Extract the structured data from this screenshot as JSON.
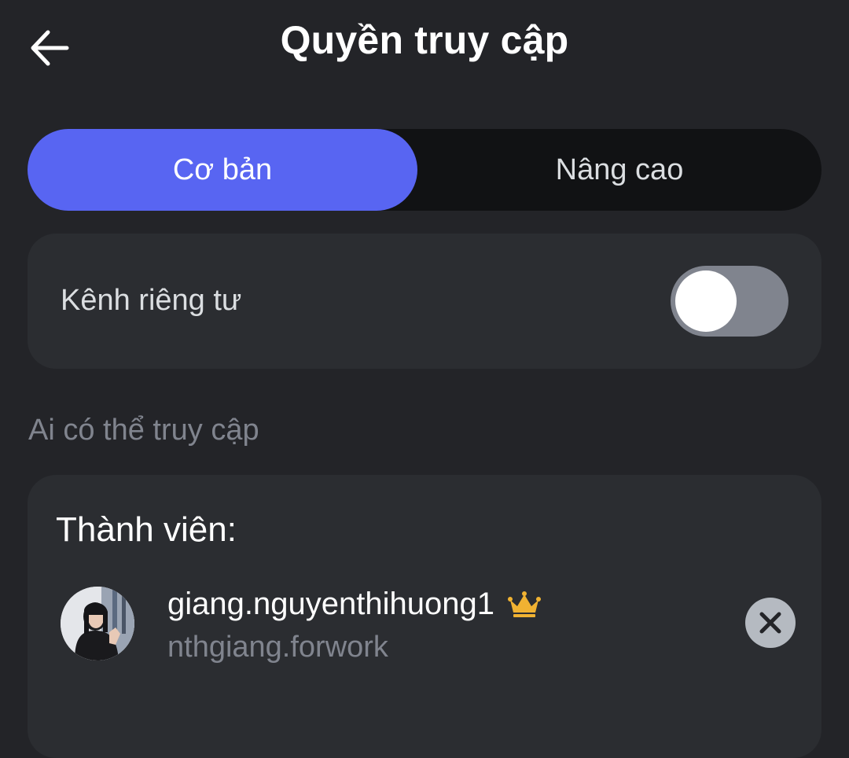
{
  "header": {
    "title": "Quyền truy cập",
    "back_icon": "arrow-left-icon"
  },
  "tabs": [
    {
      "label": "Cơ bản",
      "active": true
    },
    {
      "label": "Nâng cao",
      "active": false
    }
  ],
  "private_channel": {
    "label": "Kênh riêng tư",
    "enabled": false
  },
  "access_section": {
    "label": "Ai có thể truy cập"
  },
  "members": {
    "title": "Thành viên:",
    "items": [
      {
        "name": "giang.nguyenthihuong1",
        "username": "nthgiang.forwork",
        "badge_icon": "crown-icon",
        "remove_icon": "close-icon"
      }
    ]
  },
  "colors": {
    "background": "#232428",
    "card": "#2b2d31",
    "accent": "#5865f2",
    "crown": "#f0b232",
    "muted_text": "#80848e"
  }
}
